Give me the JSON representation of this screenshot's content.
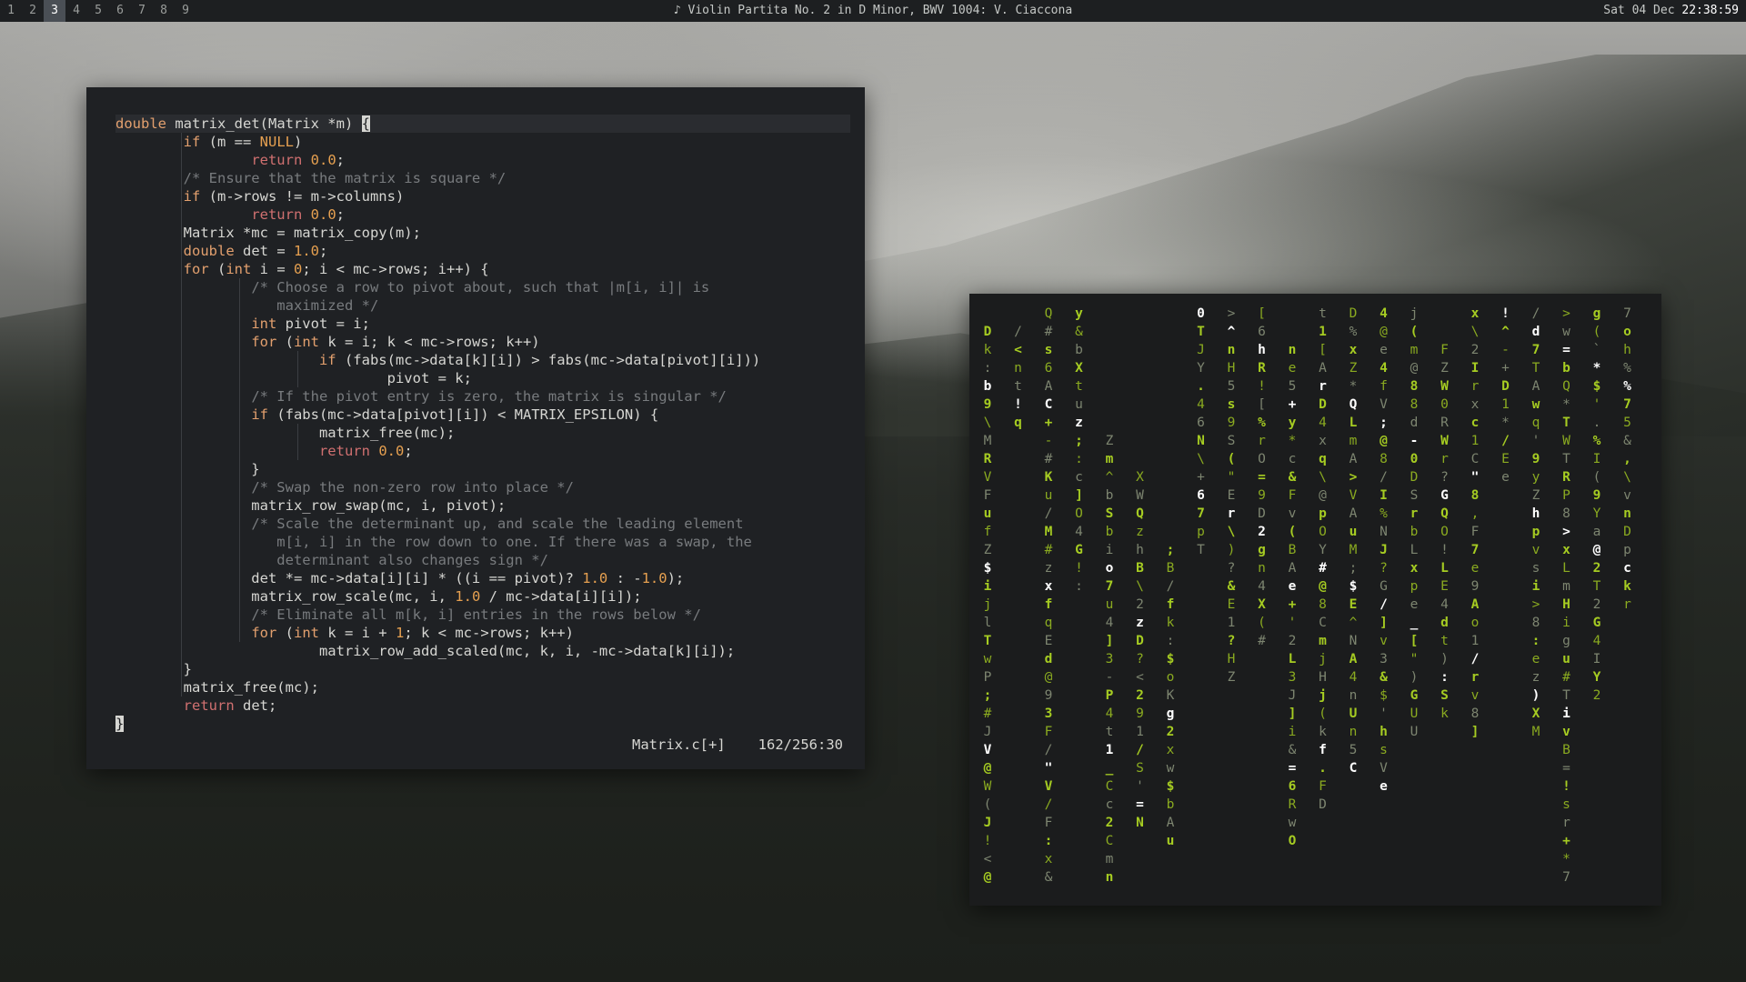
{
  "topbar": {
    "workspaces": [
      "1",
      "2",
      "3",
      "4",
      "5",
      "6",
      "7",
      "8",
      "9"
    ],
    "active_workspace": "3",
    "now_playing": "Violin Partita No. 2 in D Minor, BWV 1004: V. Ciaccona",
    "music_icon": "music-note-icon",
    "date": "Sat 04 Dec",
    "time": "22:38:59"
  },
  "editor": {
    "filename": "Matrix.c[+]",
    "position": "162/256:30",
    "code_lines": [
      "double matrix_det(Matrix *m) {",
      "        if (m == NULL)",
      "                return 0.0;",
      "        /* Ensure that the matrix is square */",
      "        if (m->rows != m->columns)",
      "                return 0.0;",
      "        Matrix *mc = matrix_copy(m);",
      "        double det = 1.0;",
      "        for (int i = 0; i < mc->rows; i++) {",
      "                /* Choose a row to pivot about, such that |m[i, i]| is",
      "                   maximized */",
      "                int pivot = i;",
      "                for (int k = i; k < mc->rows; k++)",
      "                        if (fabs(mc->data[k][i]) > fabs(mc->data[pivot][i]))",
      "                                pivot = k;",
      "                /* If the pivot entry is zero, the matrix is singular */",
      "                if (fabs(mc->data[pivot][i]) < MATRIX_EPSILON) {",
      "                        matrix_free(mc);",
      "                        return 0.0;",
      "                }",
      "                /* Swap the non-zero row into place */",
      "                matrix_row_swap(mc, i, pivot);",
      "                /* Scale the determinant up, and scale the leading element",
      "                   m[i, i] in the row down to one. If there was a swap, the",
      "                   determinant also changes sign */",
      "                det *= mc->data[i][i] * ((i == pivot)? 1.0 : -1.0);",
      "                matrix_row_scale(mc, i, 1.0 / mc->data[i][i]);",
      "                /* Eliminate all m[k, i] entries in the rows below */",
      "                for (int k = i + 1; k < mc->rows; k++)",
      "                        matrix_row_add_scaled(mc, k, i, -mc->data[k][i]);",
      "        }",
      "        matrix_free(mc);",
      "        return det;",
      "}"
    ]
  },
  "matrix_rain": {
    "columns": [
      "D k : b 9 \\ M R V F u f Z $ i j l T w P ; # J V @ W ( J ! < @",
      "/ < n t ! q",
      "Q # s 6 A C + - # K u / M # z x f q E d @ 9 3 F / \" V / F : x &",
      "y & b X t u z ; : c ] O 4 G ! :",
      "Z m ^ b S b i o 7 u 4 ] 3 - P 4 t 1 _ C c 2 C m n",
      "X W Q z h B \\ 2 z D ? < 2 9 1 / S ' = N",
      "; B / f k : $ o K g 2 x w $ b A u",
      "0 T J Y . 4 6 N \\ + 6 7 p T",
      "> ^ n H 5 s 9 S ( \" E r \\ ) ? & E 1 ? H Z",
      "[ 6 h R ! [ % r O = 9 D 2 g n 4 X ( #",
      "n e 5 + y * c & F v ( B A e + ' 2 L 3 J ] i & = 6 R w O",
      "t 1 [ A r D 4 x q \\ @ p O Y # @ 8 C m j H j ( k f . F D",
      "D % x Z * Q L m A > V A u M ; $ E ^ N A 4 n U n 5 C",
      "4 @ e 4 f V ; @ 8 / I % N J ? G / ] v 3 & $ ' h s V e",
      "j ( m @ 8 8 d - 0 D S r b L x p e _ [ \" ) G U U",
      "F Z W 0 R W r ? G Q O ! L E 4 d t ) : S k",
      "x \\ 2 I r x c 1 C \" 8 , F 7 e 9 A o 1 / r v 8 ]",
      "! ^ - + D 1 * / E e",
      "/ d 7 T A w q ' 9 y Z h p v s i > 8 : e z ) X M",
      "> w = b Q * T W T R P 8 > x L m H i g u # T i v B = ! s r + * 7",
      "g ( ` * $ ' . % I ( 9 Y a @ 2 T 2 G 4 I Y 2",
      "7 o h % % 7 5 & , \\ v n D p c k r"
    ]
  }
}
